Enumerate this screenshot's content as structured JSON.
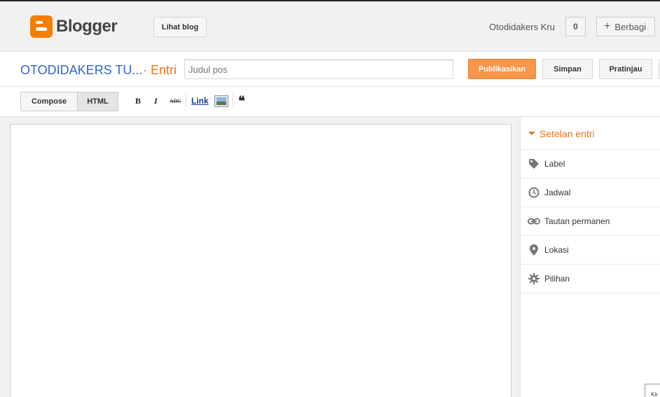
{
  "header": {
    "logo_text": "Blogger",
    "view_blog_label": "Lihat blog",
    "username": "Otodidakers Kru",
    "notification_count": "0",
    "share_label": "Berbagi"
  },
  "title_row": {
    "blog_name": "OTODIDAKERS TU...",
    "entry_label": "· Entri",
    "title_placeholder": "Judul pos",
    "publish_label": "Publikasikan",
    "save_label": "Simpan",
    "preview_label": "Pratinjau"
  },
  "toolbar": {
    "compose_label": "Compose",
    "html_label": "HTML",
    "bold": "B",
    "italic": "I",
    "strike": "ABC",
    "link": "Link",
    "quote": "❝"
  },
  "sidebar": {
    "heading": "Setelan entri",
    "items": [
      {
        "label": "Label",
        "icon": "tag-icon"
      },
      {
        "label": "Jadwal",
        "icon": "clock-icon"
      },
      {
        "label": "Tautan permanen",
        "icon": "link-icon"
      },
      {
        "label": "Lokasi",
        "icon": "location-pin-icon"
      },
      {
        "label": "Pilihan",
        "icon": "gear-icon"
      }
    ]
  },
  "corner_label": "Kir",
  "colors": {
    "accent": "#e8761b",
    "publish_bg": "#f8964a",
    "blog_name": "#3366cc"
  }
}
